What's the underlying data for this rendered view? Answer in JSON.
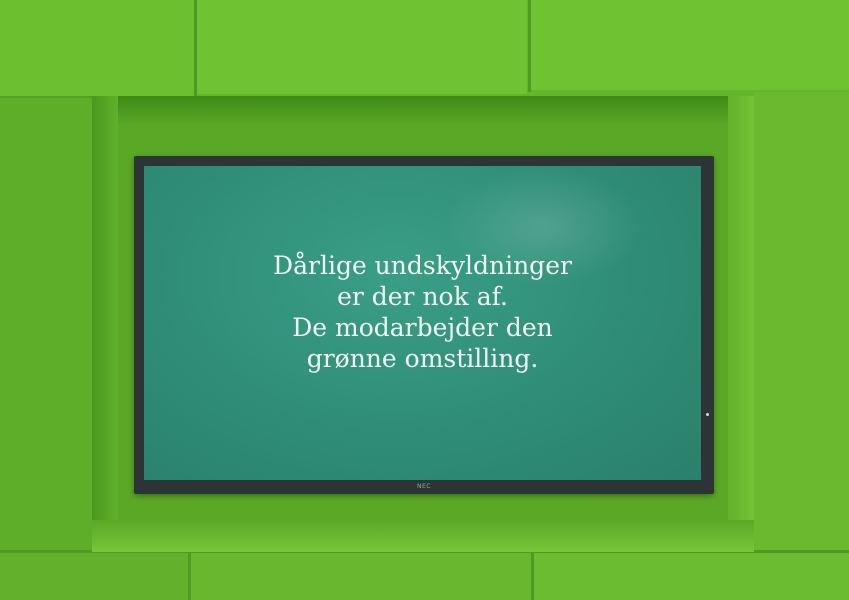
{
  "display": {
    "lines": [
      "Dårlige undskyldninger",
      "er der nok af.",
      "De modarbejder den",
      "grønne omstilling."
    ],
    "brand": "NEC"
  },
  "colors": {
    "wall": "#63b52c",
    "screen": "#2f8d76",
    "text": "#f2f6f3",
    "bezel": "#2c3436"
  }
}
